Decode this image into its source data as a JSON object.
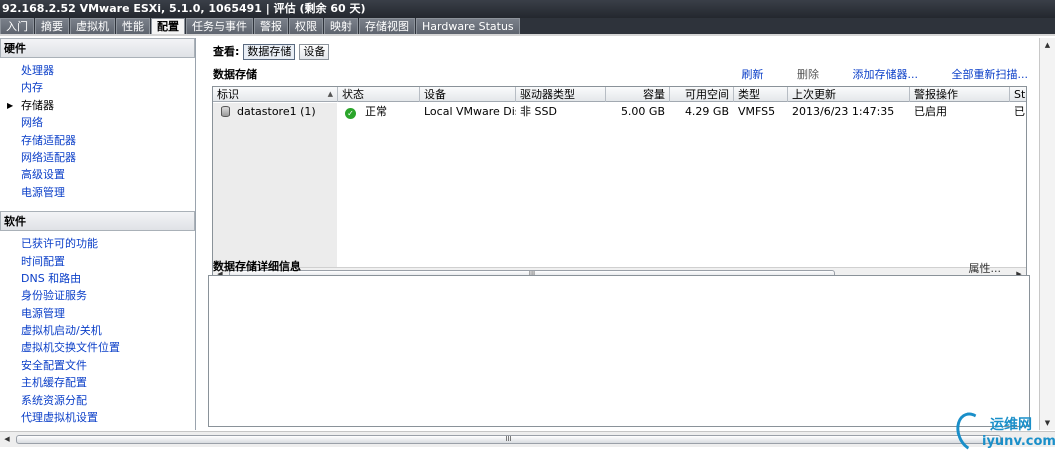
{
  "window": {
    "title": "92.168.2.52 VMware ESXi, 5.1.0, 1065491 | 评估 (剩余 60 天)"
  },
  "tabs": [
    {
      "label": "入门"
    },
    {
      "label": "摘要"
    },
    {
      "label": "虚拟机"
    },
    {
      "label": "性能"
    },
    {
      "label": "配置",
      "active": true
    },
    {
      "label": "任务与事件"
    },
    {
      "label": "警报"
    },
    {
      "label": "权限"
    },
    {
      "label": "映射"
    },
    {
      "label": "存储视图"
    },
    {
      "label": "Hardware Status"
    }
  ],
  "sidebar": {
    "hardware": {
      "title": "硬件",
      "items": [
        "处理器",
        "内存",
        "存储器",
        "网络",
        "存储适配器",
        "网络适配器",
        "高级设置",
        "电源管理"
      ],
      "selected": "存储器"
    },
    "software": {
      "title": "软件",
      "items": [
        "已获许可的功能",
        "时间配置",
        "DNS 和路由",
        "身份验证服务",
        "电源管理",
        "虚拟机启动/关机",
        "虚拟机交换文件位置",
        "安全配置文件",
        "主机缓存配置",
        "系统资源分配",
        "代理虚拟机设置"
      ]
    }
  },
  "view": {
    "label": "查看:",
    "buttons": [
      "数据存储",
      "设备"
    ],
    "active": "数据存储"
  },
  "datastores": {
    "title": "数据存储",
    "actions": {
      "refresh": "刷新",
      "delete": "删除",
      "add": "添加存储器...",
      "rescan": "全部重新扫描..."
    },
    "columns": [
      "标识",
      "状态",
      "设备",
      "驱动器类型",
      "容量",
      "可用空间",
      "类型",
      "上次更新",
      "警报操作",
      "St"
    ],
    "rows": [
      {
        "identity": "datastore1 (1)",
        "status": "正常",
        "device": "Local VMware Disk...",
        "drive_type": "非 SSD",
        "capacity": "5.00 GB",
        "free": "4.29 GB",
        "type": "VMFS5",
        "last_update": "2013/6/23 1:47:35",
        "alarm": "已启用",
        "st": "已"
      }
    ],
    "scroll_thumb": "III"
  },
  "details": {
    "title": "数据存储详细信息",
    "properties": "属性..."
  },
  "bottom_scroll_thumb": "III",
  "watermark": {
    "line1": "运维网",
    "line2": "iyunv.com"
  }
}
